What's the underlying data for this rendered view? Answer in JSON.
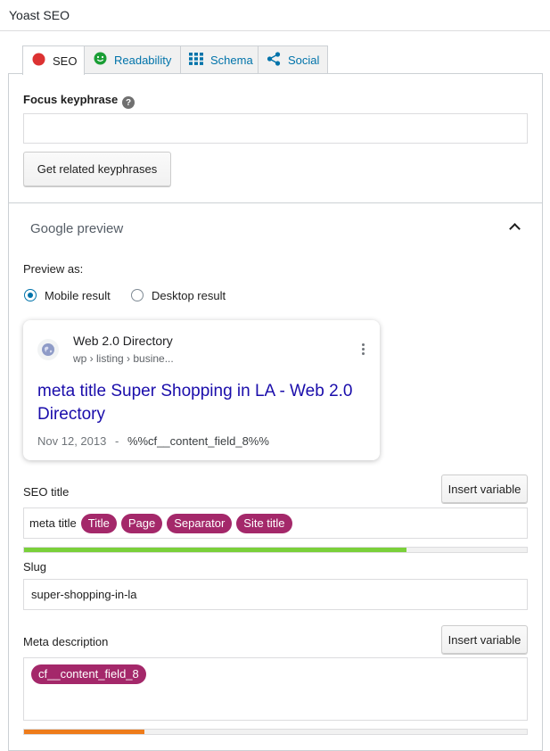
{
  "header": {
    "title": "Yoast SEO"
  },
  "tabs": [
    {
      "label": "SEO",
      "icon": "red-dot-icon",
      "active": true
    },
    {
      "label": "Readability",
      "icon": "smiley-icon",
      "active": false
    },
    {
      "label": "Schema",
      "icon": "grid-icon",
      "active": false
    },
    {
      "label": "Social",
      "icon": "share-icon",
      "active": false
    }
  ],
  "focus": {
    "label": "Focus keyphrase",
    "value": "",
    "related_button": "Get related keyphrases"
  },
  "preview": {
    "section_title": "Google preview",
    "preview_as_label": "Preview as:",
    "mobile_label": "Mobile result",
    "desktop_label": "Desktop result",
    "selected": "mobile",
    "site_name": "Web 2.0 Directory",
    "breadcrumb": "wp › listing › busine...",
    "title": "meta title Super Shopping in LA - Web 2.0 Directory",
    "date": "Nov 12, 2013",
    "separator": "-",
    "description": "%%cf__content_field_8%%"
  },
  "seo_title": {
    "label": "SEO title",
    "insert_button": "Insert variable",
    "text": "meta title",
    "pills": [
      "Title",
      "Page",
      "Separator",
      "Site title"
    ],
    "progress": 0.76,
    "progress_color": "#7ad03a"
  },
  "slug": {
    "label": "Slug",
    "value": "super-shopping-in-la"
  },
  "meta_description": {
    "label": "Meta description",
    "insert_button": "Insert variable",
    "pills": [
      "cf__content_field_8"
    ],
    "progress": 0.24,
    "progress_color": "#ee7c1b"
  },
  "colors": {
    "accent": "#0073aa",
    "pill": "#a4286a",
    "link_title": "#1a0dab"
  }
}
